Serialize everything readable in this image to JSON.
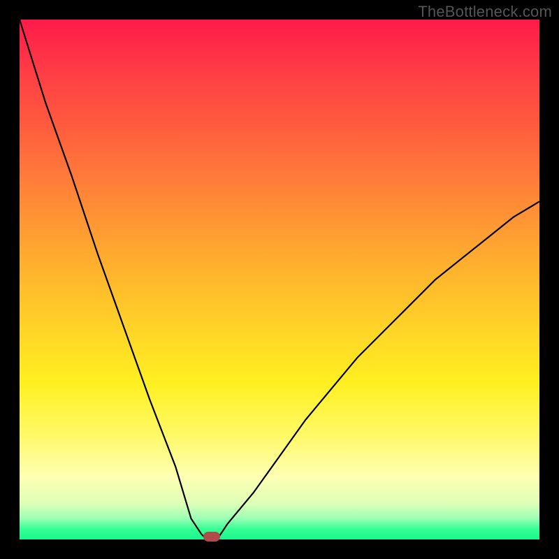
{
  "watermark": "TheBottleneck.com",
  "chart_data": {
    "type": "line",
    "title": "",
    "xlabel": "",
    "ylabel": "",
    "xlim": [
      0,
      100
    ],
    "ylim": [
      0,
      100
    ],
    "grid": false,
    "series": [
      {
        "name": "bottleneck-curve",
        "x": [
          0,
          5,
          10,
          15,
          20,
          25,
          30,
          33,
          35,
          36,
          37,
          38,
          40,
          45,
          50,
          55,
          60,
          65,
          70,
          75,
          80,
          85,
          90,
          95,
          100
        ],
        "y": [
          100,
          84,
          70,
          55,
          41,
          27,
          14,
          4,
          1,
          0,
          0,
          0,
          3,
          9,
          16,
          23,
          29,
          35,
          40,
          45,
          50,
          54,
          58,
          62,
          65
        ]
      }
    ],
    "annotations": [
      {
        "name": "optimal-marker",
        "x": 37,
        "y": 0.5
      }
    ],
    "background_gradient": [
      "#ff1a4a",
      "#ff5a3e",
      "#ff9a33",
      "#ffd527",
      "#fff968",
      "#feffb3",
      "#9affb5",
      "#19f78c"
    ]
  }
}
